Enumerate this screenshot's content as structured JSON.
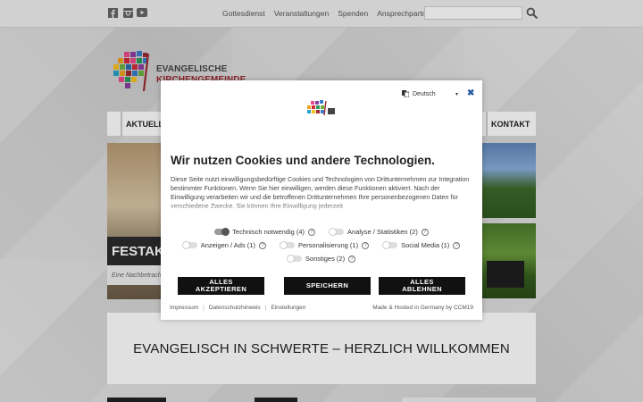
{
  "topbar": {
    "social": [
      {
        "name": "facebook-icon"
      },
      {
        "name": "instagram-icon"
      },
      {
        "name": "youtube-icon"
      }
    ],
    "nav": [
      "Gottesdienst",
      "Veranstaltungen",
      "Spenden",
      "Ansprechpartner"
    ],
    "search_placeholder": ""
  },
  "logo": {
    "line1": "EVANGELISCHE",
    "line2": "KIRCHENGEMEINDE"
  },
  "mainnav": {
    "left": "AKTUELLES",
    "right": "KONTAKT"
  },
  "slider": {
    "caption": "FESTAKT S",
    "sub": "Eine Nachbetrach"
  },
  "welcome": {
    "title": "EVANGELISCH IN SCHWERTE – HERZLICH WILLKOMMEN"
  },
  "cookie": {
    "language": "Deutsch",
    "close": "✖",
    "title": "Wir nutzen Cookies und andere Technologien.",
    "text": "Diese Seite nutzt einwilligungsbedürftige Cookies und Technologien von Drittunternehmen zur Integration bestimmter Funktionen. Wenn Sie hier einwilligen, werden diese Funktionen aktiviert. Nach der Einwilligung verarbeiten wir und die betroffenen Drittunternehmen Ihre personenbezogenen Daten für verschiedene Zwecke. Sie können Ihre Einwilligung jederzeit",
    "toggles_row1": [
      {
        "label": "Technisch notwendig (4)",
        "on": true
      },
      {
        "label": "Analyse / Statistiken (2)",
        "on": false
      }
    ],
    "toggles_row2": [
      {
        "label": "Anzeigen / Ads (1)",
        "on": false
      },
      {
        "label": "Personalisierung (1)",
        "on": false
      },
      {
        "label": "Social Media (1)",
        "on": false
      }
    ],
    "toggles_row3": [
      {
        "label": "Sonstiges (2)",
        "on": false
      }
    ],
    "help_glyph": "?",
    "buttons": {
      "accept_all": [
        "ALLES",
        "AKZEPTIEREN"
      ],
      "save": "SPEICHERN",
      "reject_all": [
        "ALLES",
        "ABLEHNEN"
      ]
    },
    "footer_links": [
      "Impressum",
      "Datenschutzhinweis",
      "Einstellungen"
    ],
    "footer_separator": "|",
    "footer_right": "Made & Hosted in Germany by CCM19"
  }
}
